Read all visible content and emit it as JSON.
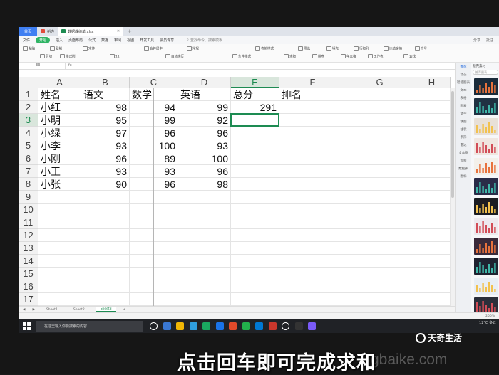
{
  "tabs": {
    "home": "首页",
    "stencil": "稻壳",
    "doc": "数据成绩单.xlsx"
  },
  "menu": {
    "items": [
      "文件",
      "开始",
      "插入",
      "页面布局",
      "公式",
      "数据",
      "审阅",
      "视图",
      "开发工具",
      "会员专享"
    ],
    "active": "开始",
    "search": "查找命令、搜索模板",
    "right": [
      "分享",
      "批注"
    ]
  },
  "ribbon": {
    "items": [
      "粘贴",
      "剪切",
      "复制",
      "格式刷",
      "宋体",
      "11",
      "合并居中",
      "自动换行",
      "常规",
      "条件格式",
      "表格样式",
      "求和",
      "筛选",
      "排序",
      "填充",
      "单元格",
      "行和列",
      "工作表",
      "冻结窗格",
      "查找",
      "符号"
    ]
  },
  "formula_bar": {
    "name_box": "E3",
    "fx": "fx",
    "content": ""
  },
  "columns": [
    "A",
    "B",
    "C",
    "D",
    "E",
    "F",
    "G",
    "H"
  ],
  "selected_column": "E",
  "rows": [
    "1",
    "2",
    "3",
    "4",
    "5",
    "6",
    "7",
    "8",
    "9",
    "10",
    "11",
    "12",
    "13",
    "14",
    "15",
    "16",
    "17"
  ],
  "selected_row": "3",
  "table": {
    "headers": [
      "姓名",
      "语文",
      "数学",
      "英语",
      "总分",
      "排名"
    ],
    "records": [
      {
        "name": "小红",
        "chinese": "98",
        "math": "94",
        "english": "99",
        "total": "291"
      },
      {
        "name": "小明",
        "chinese": "95",
        "math": "99",
        "english": "92",
        "total": ""
      },
      {
        "name": "小绿",
        "chinese": "97",
        "math": "96",
        "english": "96",
        "total": ""
      },
      {
        "name": "小李",
        "chinese": "93",
        "math": "100",
        "english": "93",
        "total": ""
      },
      {
        "name": "小刚",
        "chinese": "96",
        "math": "89",
        "english": "100",
        "total": ""
      },
      {
        "name": "小王",
        "chinese": "93",
        "math": "93",
        "english": "96",
        "total": ""
      },
      {
        "name": "小张",
        "chinese": "90",
        "math": "96",
        "english": "98",
        "total": ""
      }
    ]
  },
  "sheet_tabs": [
    "Sheet1",
    "Sheet2",
    "Sheet3"
  ],
  "active_sheet": "Sheet3",
  "pane": {
    "title": "稻壳素材",
    "search": "推荐图表",
    "nav": [
      "推荐",
      "动态",
      "智能图表",
      "文本",
      "表格",
      "图表",
      "文字",
      "饼图",
      "柱状",
      "条形",
      "雷达",
      "文本框",
      "流程",
      "数据表",
      "图标"
    ],
    "thumb_colors": [
      "#1b2b3a",
      "#203142",
      "#e8e0d8",
      "#f0e6e0",
      "#f3f0ea",
      "#2a2c48",
      "#1c1d22",
      "#ede9ee",
      "#3a2a3a",
      "#1f2230",
      "#e8eef5",
      "#2b2f3a"
    ]
  },
  "status": {
    "zoom": "256%"
  },
  "taskbar": {
    "search": "在这里输入你要搜索的内容",
    "tray_time": "",
    "tray_temp": "12°C 多云",
    "icon_colors": [
      "#ffffff",
      "#3a78d4",
      "#f2b705",
      "#2f9fe0",
      "#1aa760",
      "#1a73e8",
      "#e34a2a",
      "#22b14c",
      "#0078d4",
      "#c9372c",
      "#ffffff",
      "#333333",
      "#7a5af8"
    ]
  },
  "overlay": {
    "subtitle": "点击回车即可完成求和",
    "watermark": "天奇生活",
    "url": "gbaike.com"
  }
}
